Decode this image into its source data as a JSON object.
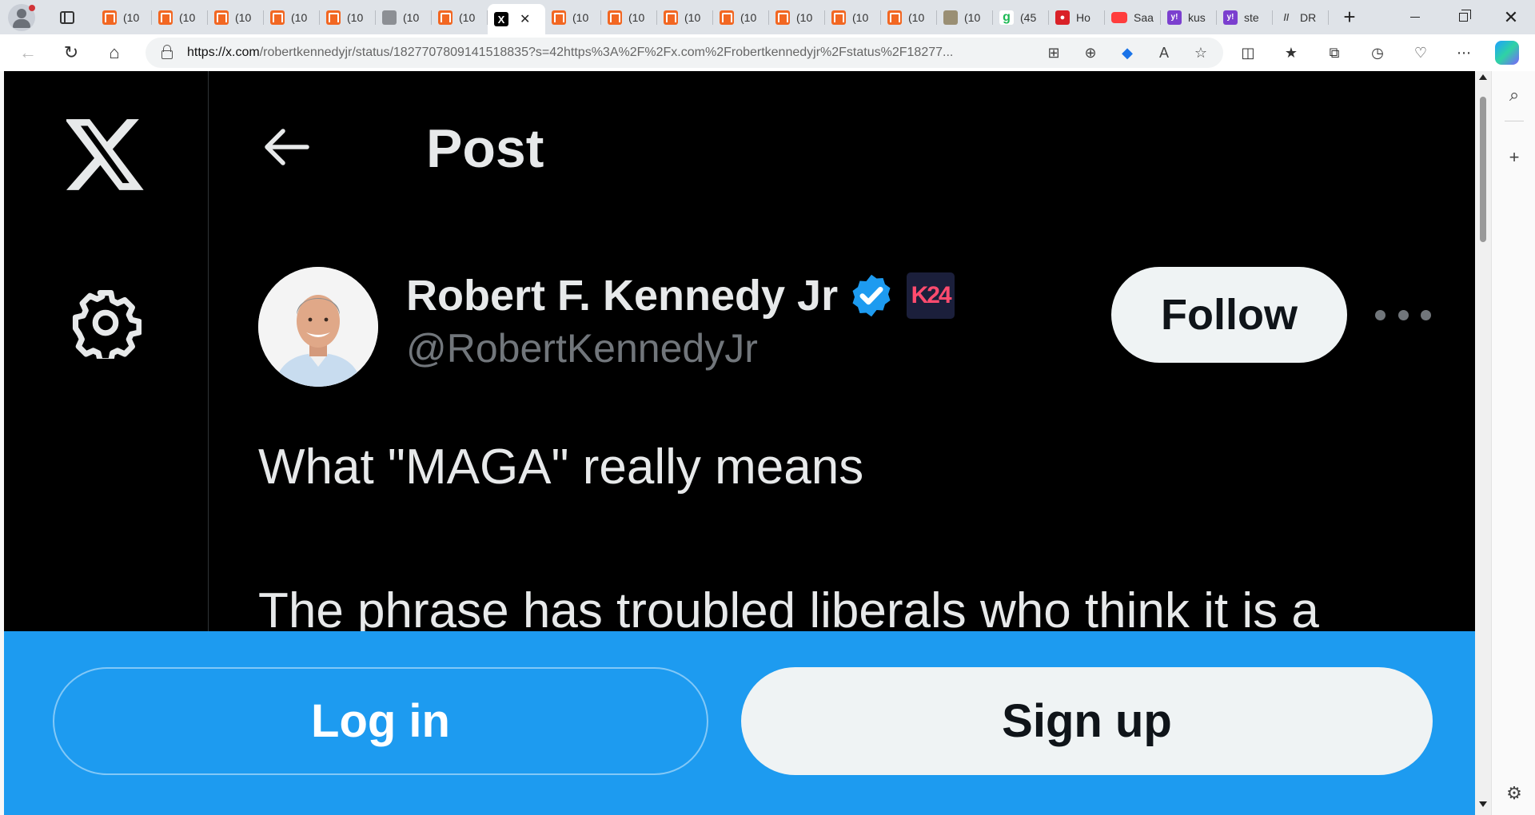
{
  "browser": {
    "tabs": [
      {
        "label": "(10",
        "favicon": "orange-bookmark-icon"
      },
      {
        "label": "(10",
        "favicon": "orange-bookmark-icon"
      },
      {
        "label": "(10",
        "favicon": "orange-bookmark-icon"
      },
      {
        "label": "(10",
        "favicon": "orange-bookmark-icon"
      },
      {
        "label": "(10",
        "favicon": "orange-bookmark-icon"
      },
      {
        "label": "(10",
        "favicon": "gray-image-icon"
      },
      {
        "label": "(10",
        "favicon": "orange-bookmark-icon"
      },
      {
        "label": "",
        "favicon": "x-logo-icon",
        "active": true
      },
      {
        "label": "(10",
        "favicon": "orange-bookmark-icon"
      },
      {
        "label": "(10",
        "favicon": "orange-bookmark-icon"
      },
      {
        "label": "(10",
        "favicon": "orange-bookmark-icon"
      },
      {
        "label": "(10",
        "favicon": "orange-bookmark-icon"
      },
      {
        "label": "(10",
        "favicon": "orange-bookmark-icon"
      },
      {
        "label": "(10",
        "favicon": "orange-bookmark-icon"
      },
      {
        "label": "(10",
        "favicon": "orange-bookmark-icon"
      },
      {
        "label": "(10",
        "favicon": "grass-image-icon"
      },
      {
        "label": "(45",
        "favicon": "green-g-icon"
      },
      {
        "label": "Ho",
        "favicon": "red-app-icon"
      },
      {
        "label": "Saa",
        "favicon": "youtube-icon"
      },
      {
        "label": "kus",
        "favicon": "yahoo-icon"
      },
      {
        "label": "ste",
        "favicon": "yahoo-icon"
      },
      {
        "label": "DR",
        "favicon": "dr-icon"
      }
    ],
    "url_host": "https://x.com",
    "url_path": "/robertkennedyjr/status/1827707809141518835?s=42https%3A%2F%2Fx.com%2Frobertkennedyjr%2Fstatus%2F18277..."
  },
  "page": {
    "title": "Post",
    "author": {
      "name": "Robert F. Kennedy Jr",
      "handle": "@RobertKennedyJr",
      "affiliate_badge": "K24"
    },
    "follow_label": "Follow",
    "post_lines": [
      "What \"MAGA\" really means",
      "The phrase has troubled liberals who think it is a"
    ],
    "login_label": "Log in",
    "signup_label": "Sign up"
  },
  "colors": {
    "accent": "#1d9bf0",
    "background": "#000000",
    "text": "#e7e9ea",
    "secondary_text": "#71767b",
    "button_light": "#eff3f4"
  }
}
